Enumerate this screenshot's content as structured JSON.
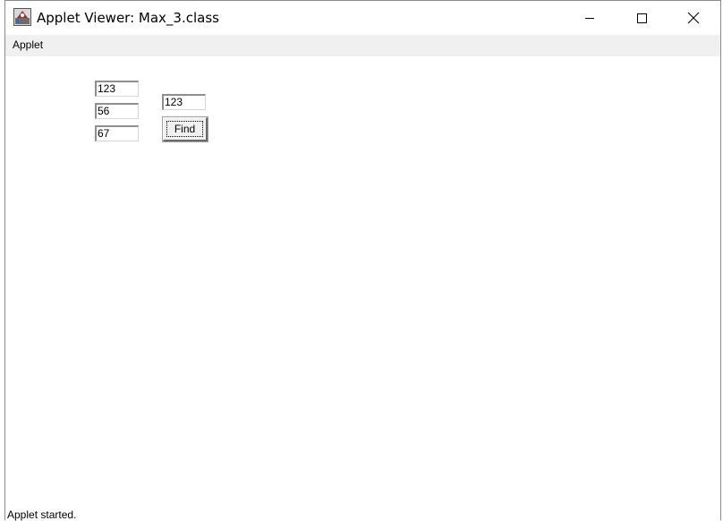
{
  "window": {
    "title": "Applet Viewer: Max_3.class",
    "icon": "java-applet-icon",
    "controls": [
      "minimize-icon",
      "maximize-icon",
      "close-icon"
    ]
  },
  "menubar": {
    "items": [
      {
        "label": "Applet"
      }
    ]
  },
  "form": {
    "input1": "123",
    "input2": "56",
    "input3": "67",
    "result": "123",
    "find_label": "Find"
  },
  "status": {
    "text": "Applet started."
  },
  "colors": {
    "menubar_bg": "#f0f0f0",
    "button_bg": "#f0f0f0",
    "content_bg": "#ffffff"
  }
}
